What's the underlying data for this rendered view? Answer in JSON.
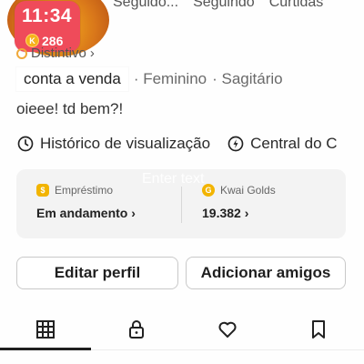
{
  "status": {
    "time": "11:34",
    "coins": "286",
    "coin_symbol": "K"
  },
  "stats": {
    "items": [
      "Seguido...",
      "Seguindo",
      "Curtidas"
    ]
  },
  "profile": {
    "badge_label": "Distintivo",
    "badge_chevron": "›",
    "tag_primary": "conta a venda",
    "tag_gender": "· Feminino",
    "tag_zodiac": "· Sagitário",
    "bio": "oieee! td bem?!"
  },
  "quick_links": {
    "history_label": "Histórico de visualização",
    "center_label": "Central do C"
  },
  "overlay": {
    "enter_text": "Enter text"
  },
  "wallet": {
    "loan_label": "Empréstimo",
    "loan_value": "Em andamento ›",
    "gold_label": "Kwai Golds",
    "gold_value": "19.382 ›",
    "bag_symbol": "$",
    "gold_symbol": "G"
  },
  "actions": {
    "edit_label": "Editar perfil",
    "add_label": "Adicionar amigos"
  },
  "tabs": {
    "icons": [
      "grid-icon",
      "lock-icon",
      "heart-icon",
      "bookmark-icon"
    ]
  }
}
